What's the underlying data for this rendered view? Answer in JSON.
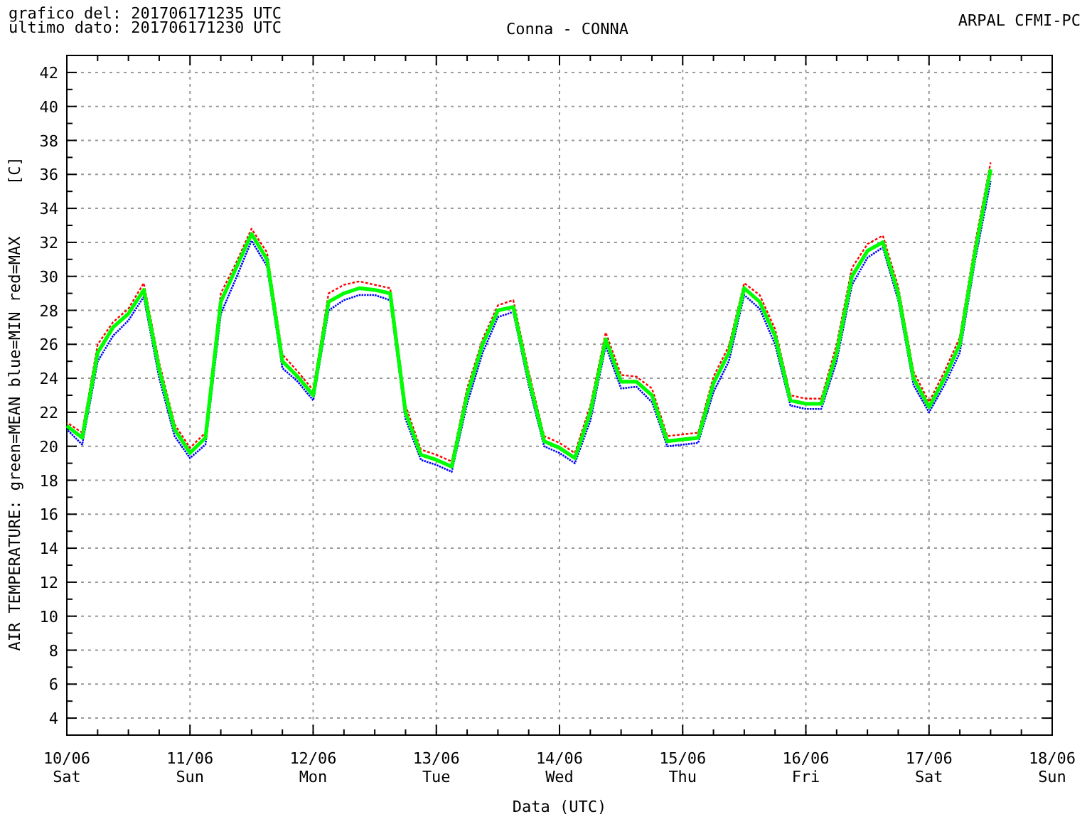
{
  "header": {
    "lines": [
      "grafico del: 201706171235 UTC",
      "ultimo dato: 201706171230 UTC"
    ],
    "title": "Conna - CONNA",
    "source": "ARPAL CFMI-PC"
  },
  "chart": {
    "y_unit": "[C]",
    "chart_data": {
      "type": "line",
      "xlabel": "Data (UTC)",
      "ylabel": "AIR TEMPERATURE:",
      "categories": [
        "10/06 Sat",
        null,
        null,
        null,
        null,
        null,
        null,
        null,
        "11/06 Sun",
        null,
        null,
        null,
        null,
        null,
        null,
        null,
        "12/06 Mon",
        null,
        null,
        null,
        null,
        null,
        null,
        null,
        "13/06 Tue",
        null,
        null,
        null,
        null,
        null,
        null,
        null,
        "14/06 Wed",
        null,
        null,
        null,
        null,
        null,
        null,
        null,
        "15/06 Thu",
        null,
        null,
        null,
        null,
        null,
        null,
        null,
        "16/06 Fri",
        null,
        null,
        null,
        null,
        null,
        null,
        null,
        "17/06 Sat",
        null,
        null,
        null,
        null,
        null,
        null,
        null,
        "18/06 Sun"
      ],
      "series": [
        {
          "name": "green=MEAN",
          "color": "#00ff00",
          "line_style": "solid",
          "values": [
            21.2,
            20.5,
            25.5,
            27.0,
            27.8,
            29.2,
            24.5,
            21.0,
            19.6,
            20.5,
            28.5,
            30.5,
            32.5,
            31.0,
            25.0,
            24.1,
            23.0,
            28.5,
            29.0,
            29.3,
            29.2,
            29.0,
            22.0,
            19.5,
            19.2,
            18.8,
            23.0,
            26.0,
            28.0,
            28.2,
            24.0,
            20.3,
            19.9,
            19.3,
            22.0,
            26.3,
            23.8,
            23.8,
            23.0,
            20.3,
            20.4,
            20.5,
            23.7,
            25.5,
            29.3,
            28.5,
            26.5,
            22.7,
            22.5,
            22.5,
            25.5,
            30.0,
            31.5,
            32.0,
            29.0,
            24.0,
            22.3,
            24.0,
            26.0,
            31.5,
            36.3,
            null,
            null,
            null,
            null
          ]
        },
        {
          "name": "blue=MIN",
          "color": "#0000ff",
          "line_style": "dotted",
          "values": [
            21.0,
            20.1,
            25.0,
            26.5,
            27.4,
            28.8,
            24.0,
            20.6,
            19.3,
            20.1,
            27.8,
            29.9,
            32.1,
            30.6,
            24.6,
            23.8,
            22.7,
            28.0,
            28.6,
            28.9,
            28.9,
            28.6,
            21.6,
            19.2,
            18.9,
            18.5,
            22.5,
            25.5,
            27.6,
            27.9,
            23.6,
            20.0,
            19.6,
            19.0,
            21.5,
            25.9,
            23.4,
            23.5,
            22.6,
            20.0,
            20.1,
            20.2,
            23.2,
            25.0,
            28.9,
            28.1,
            26.0,
            22.4,
            22.2,
            22.2,
            25.0,
            29.5,
            31.1,
            31.7,
            28.6,
            23.6,
            22.0,
            23.6,
            25.5,
            31.0,
            35.6,
            null,
            null,
            null,
            null
          ]
        },
        {
          "name": "red=MAX",
          "color": "#ff0000",
          "line_style": "dashed",
          "values": [
            21.4,
            20.8,
            26.0,
            27.3,
            28.1,
            29.6,
            24.9,
            21.3,
            19.9,
            20.8,
            29.0,
            30.8,
            32.8,
            31.4,
            25.4,
            24.4,
            23.3,
            29.0,
            29.5,
            29.7,
            29.5,
            29.3,
            22.4,
            19.8,
            19.5,
            19.1,
            23.4,
            26.3,
            28.3,
            28.6,
            24.4,
            20.6,
            20.2,
            19.6,
            22.4,
            26.7,
            24.2,
            24.1,
            23.4,
            20.6,
            20.7,
            20.8,
            24.1,
            25.9,
            29.6,
            28.9,
            26.9,
            23.0,
            22.8,
            22.8,
            26.0,
            30.5,
            31.9,
            32.4,
            29.4,
            24.4,
            22.6,
            24.4,
            26.4,
            32.0,
            36.7,
            null,
            null,
            null,
            null
          ]
        }
      ],
      "grid": true,
      "ylim": [
        3,
        43
      ],
      "yticks": [
        4,
        6,
        8,
        10,
        12,
        14,
        16,
        18,
        20,
        22,
        24,
        26,
        28,
        30,
        32,
        34,
        36,
        38,
        40,
        42
      ]
    }
  }
}
